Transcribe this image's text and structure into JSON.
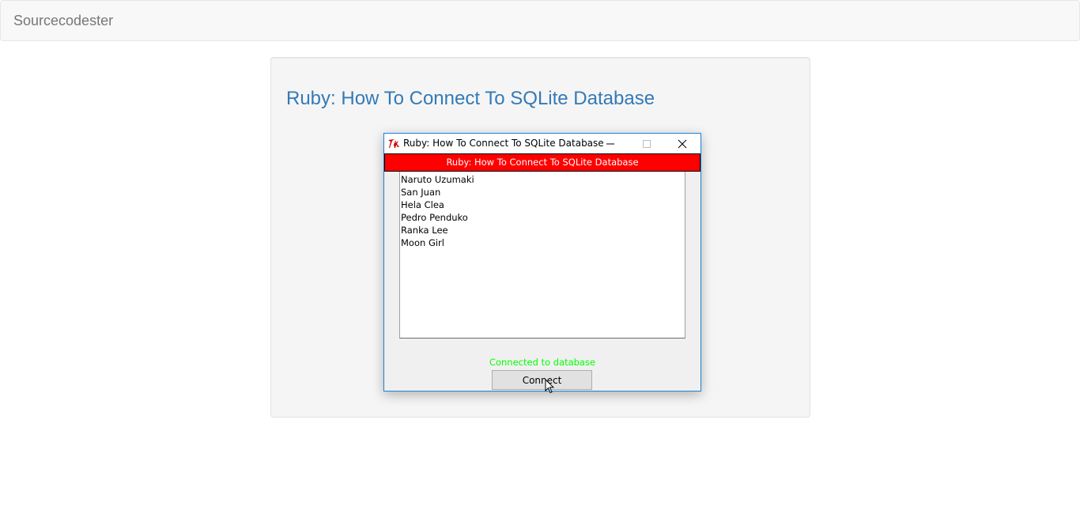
{
  "navbar": {
    "brand": "Sourcecodester"
  },
  "main": {
    "title": "Ruby: How To Connect To SQLite Database"
  },
  "window": {
    "title": "Ruby: How To Connect To SQLite Database",
    "icon": "tk-feather-icon",
    "controls": [
      "minimize-icon",
      "maximize-icon",
      "close-icon"
    ],
    "header_label": "Ruby: How To Connect To SQLite Database",
    "header_bg": "#ff0000",
    "list_items": [
      "Naruto Uzumaki",
      "San Juan",
      "Hela Clea",
      "Pedro Penduko",
      "Ranka Lee",
      "Moon Girl"
    ],
    "status": "Connected to database",
    "status_color": "#00ff00",
    "connect_label": "Connect"
  }
}
